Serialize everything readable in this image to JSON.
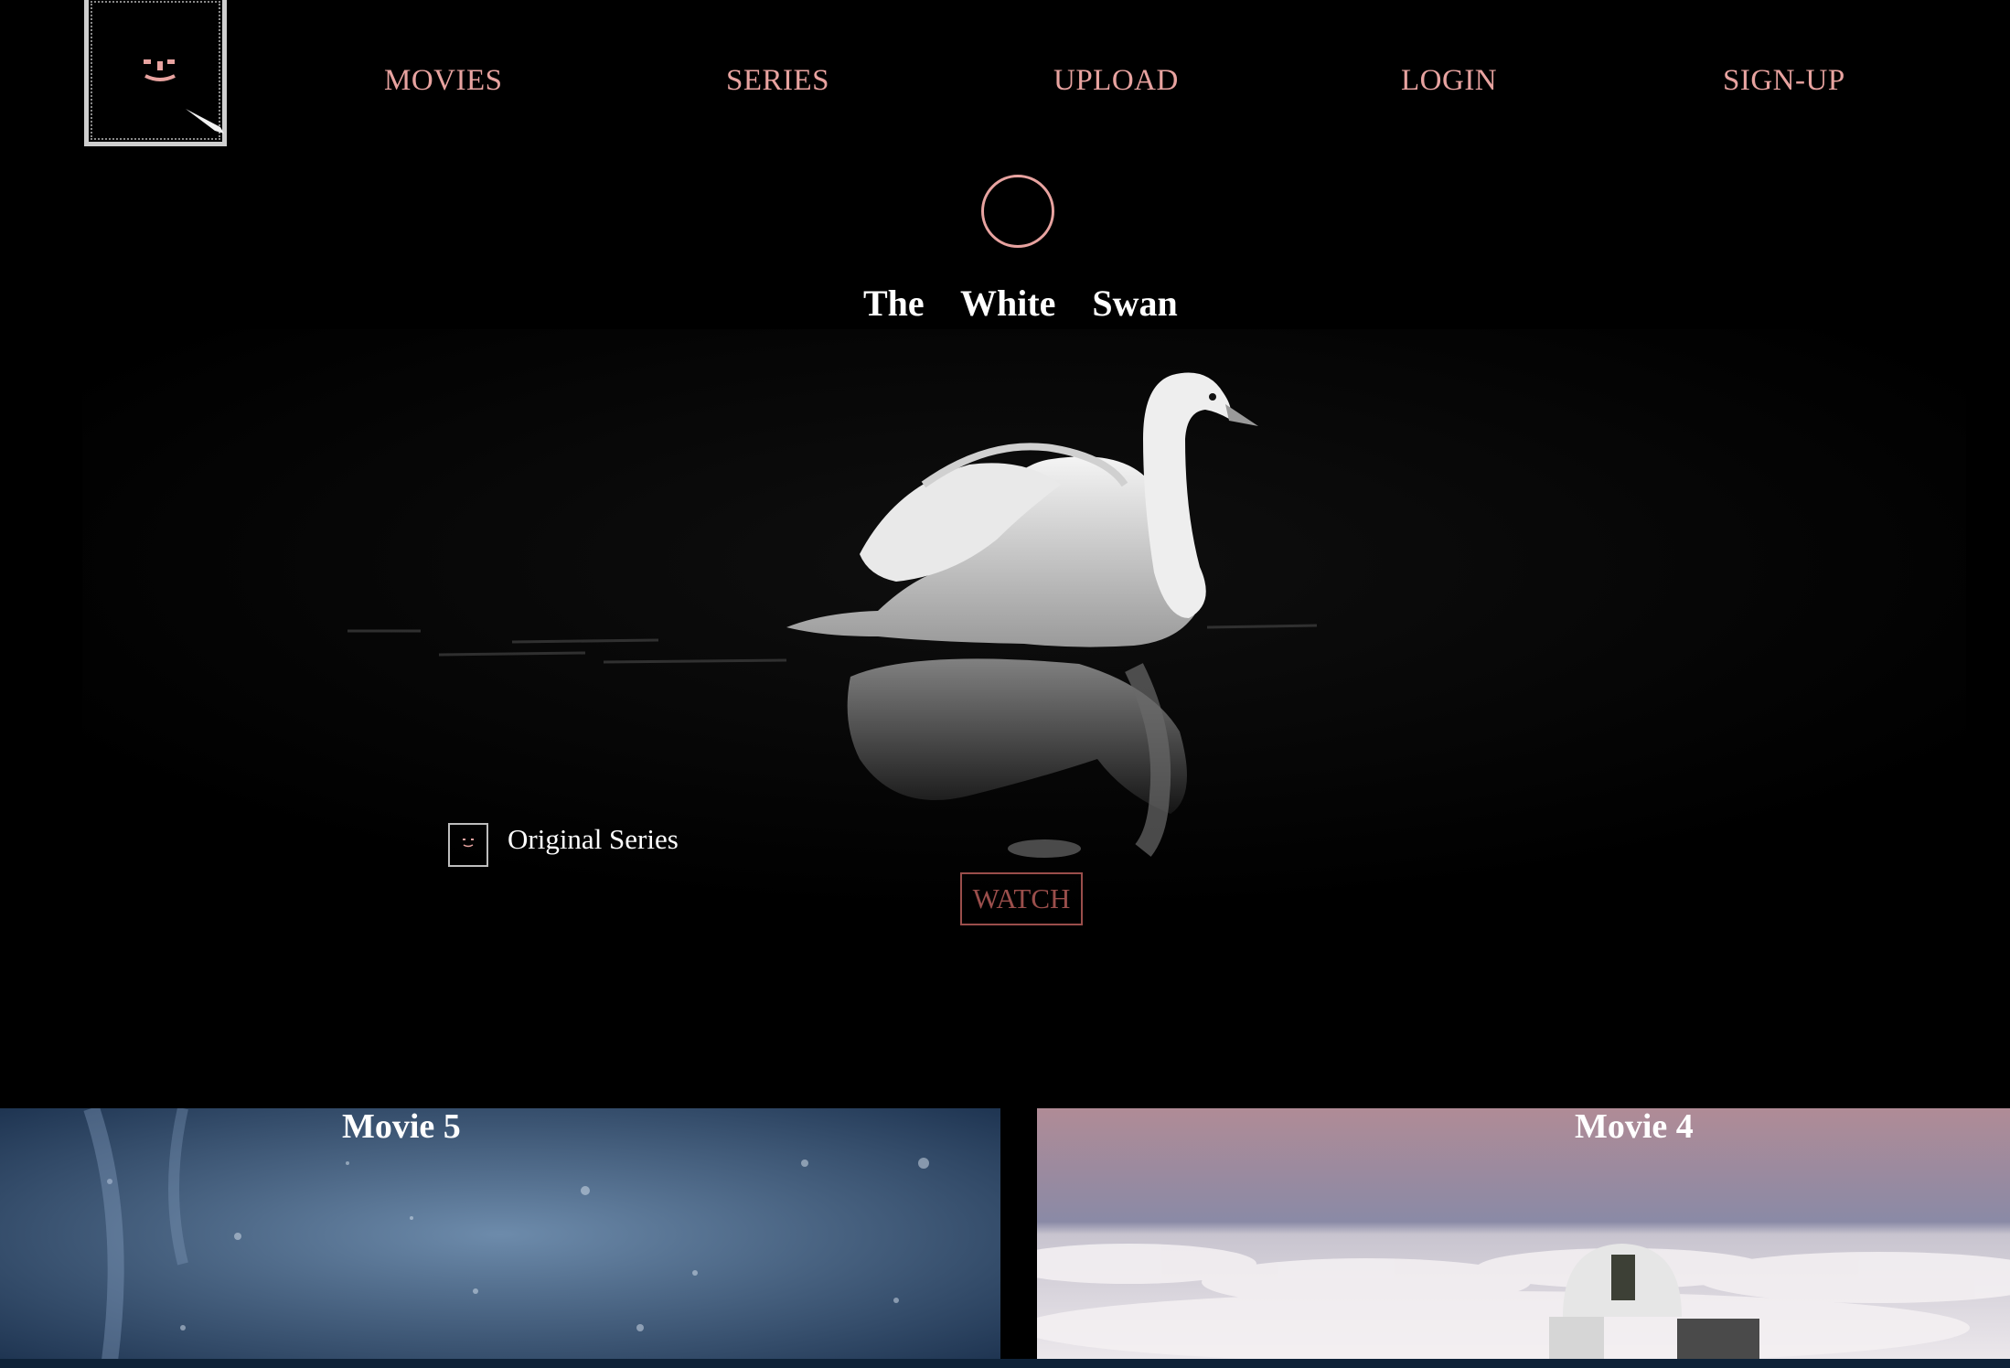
{
  "nav": {
    "items": [
      {
        "label": "MOVIES"
      },
      {
        "label": "SERIES"
      },
      {
        "label": "UPLOAD"
      },
      {
        "label": "LOGIN"
      },
      {
        "label": "SIGN-UP"
      }
    ]
  },
  "hero": {
    "title": "The White Swan",
    "badge_label": "Original Series",
    "watch_label": "WATCH",
    "play_icon": "circle-play-icon"
  },
  "movies": [
    {
      "title": "Movie 5"
    },
    {
      "title": "Movie 4"
    }
  ],
  "colors": {
    "accent": "#e8a3a0",
    "watch": "#9a4e4b",
    "background": "#000000"
  }
}
